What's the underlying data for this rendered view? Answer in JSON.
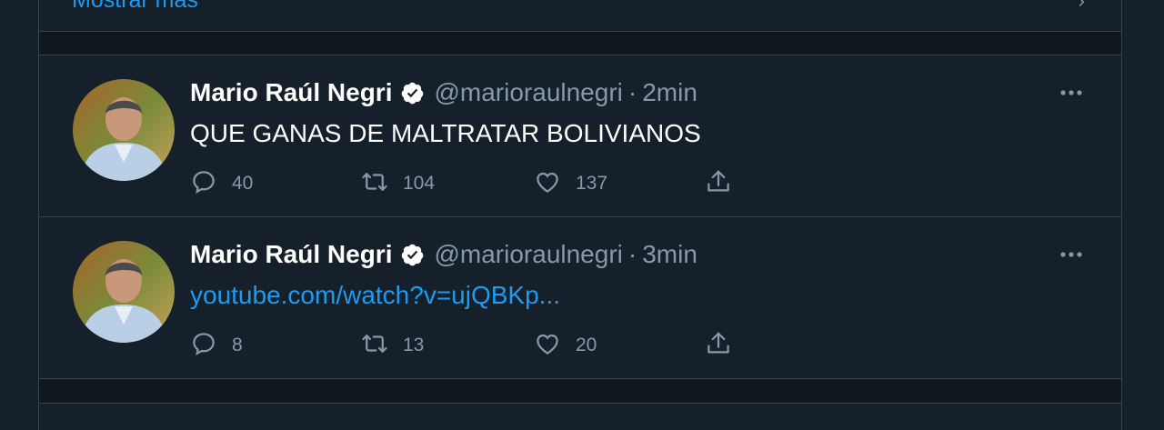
{
  "show_more": {
    "label": "Mostrar más"
  },
  "tweets": [
    {
      "name": "Mario Raúl Negri",
      "handle": "@marioraulnegri",
      "separator": "·",
      "time": "2min",
      "text": "QUE GANAS DE MALTRATAR BOLIVIANOS",
      "is_link": false,
      "replies": "40",
      "retweets": "104",
      "likes": "137"
    },
    {
      "name": "Mario Raúl Negri",
      "handle": "@marioraulnegri",
      "separator": "·",
      "time": "3min",
      "text": "youtube.com/watch?v=ujQBKp...",
      "is_link": true,
      "replies": "8",
      "retweets": "13",
      "likes": "20"
    }
  ],
  "colors": {
    "background": "#15202b",
    "border": "#38444d",
    "muted_text": "#8899a6",
    "link": "#1d9bf0",
    "text": "#ffffff"
  },
  "icons": [
    "verified-badge-icon",
    "more-options-icon",
    "reply-icon",
    "retweet-icon",
    "like-icon",
    "share-icon"
  ]
}
